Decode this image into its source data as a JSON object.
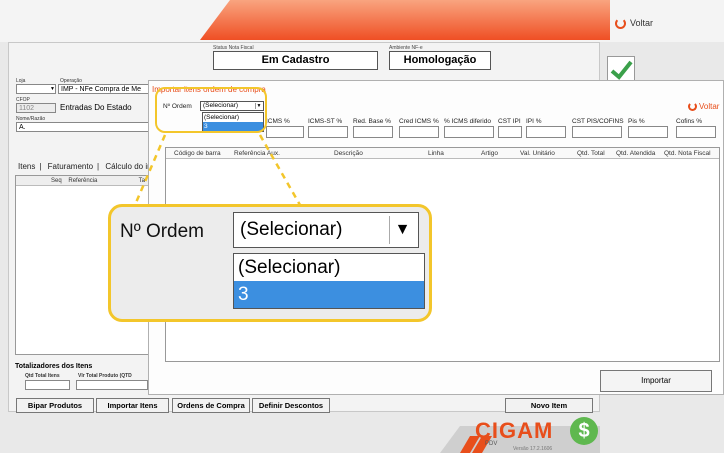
{
  "top": {
    "voltar_label": "Voltar"
  },
  "status": {
    "status_label": "Status Nota Fiscal",
    "status_value": "Em Cadastro",
    "ambiente_label": "Ambiente NF-e",
    "ambiente_value": "Homologação"
  },
  "form": {
    "loja_label": "Loja",
    "operacao_label": "Operação",
    "operacao_value": "IMP - NFe Compra de Me",
    "cfop_label": "CFOP",
    "cfop_value": "1102",
    "cfop_desc": "Entradas Do Estado",
    "nome_label": "Nome/Razão",
    "nome_value": "A."
  },
  "tabs": [
    "Itens",
    "Faturamento",
    "Cálculo do im"
  ],
  "left_grid": {
    "col_seq": "Seq",
    "col_ref": "Referência",
    "col_ta": "Ta"
  },
  "totals": {
    "title": "Totalizadores dos Itens",
    "qtd_label": "Qtd Total Itens",
    "val_label": "Vlr Total Produto (QTD"
  },
  "buttons": {
    "bipar": "Bipar Produtos",
    "importar_itens": "Importar Itens",
    "ordens": "Ordens de Compra",
    "descontos": "Definir Descontos",
    "novo_item": "Novo Item"
  },
  "dialog": {
    "title": "Importar itens ordem de compra",
    "ordem_label": "Nº Ordem",
    "select_value": "(Selecionar)",
    "options": [
      "(Selecionar)",
      "3"
    ],
    "selected_option_index": 1,
    "voltar_label": "Voltar",
    "field_headers": [
      "ICMS %",
      "ICMS-ST %",
      "Red. Base %",
      "Cred ICMS %",
      "% ICMS diferido",
      "CST IPI",
      "IPI %",
      "CST PIS/COFINS",
      "Pis %",
      "Cofins %"
    ],
    "columns": [
      "Código de barra",
      "Referência Aux.",
      "Descrição",
      "Linha",
      "Artigo",
      "Val. Unitário",
      "Qtd. Total",
      "Qtd. Atendida",
      "Qtd. Nota Fiscal"
    ],
    "importar_label": "Importar"
  },
  "zoom": {
    "label": "Nº Ordem",
    "select_value": "(Selecionar)",
    "options": [
      "(Selecionar)",
      "3"
    ]
  },
  "logo": {
    "brand": "CIGAM",
    "sub": "PDV",
    "version": "Versão 17.2.1606",
    "dollar": "$"
  },
  "colors": {
    "accent": "#e84e1b",
    "highlight": "#f3c62b",
    "selection": "#3c8fe0"
  }
}
